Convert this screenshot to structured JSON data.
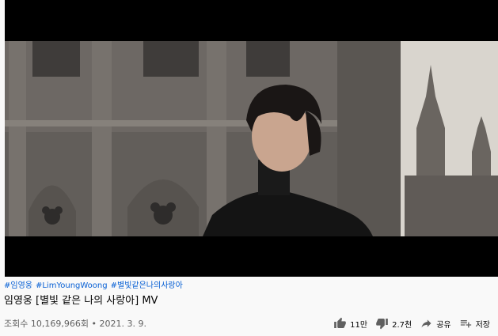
{
  "video": {
    "hashtags": [
      "#임영웅",
      "#LimYoungWoong",
      "#별빛같은나의사랑아"
    ],
    "title": "임영웅 [별빛 같은 나의 사랑아] MV",
    "views": "조회수 10,169,966회",
    "separator": "•",
    "date": "2021. 3. 9."
  },
  "actions": {
    "like": "11만",
    "dislike": "2.7천",
    "share": "공유",
    "save": "저장"
  },
  "colors": {
    "hashtag": "#065fd4",
    "text": "#030303",
    "meta": "#606060"
  }
}
